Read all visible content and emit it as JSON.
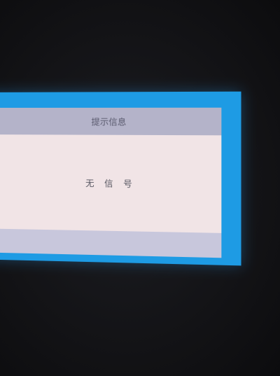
{
  "dialog": {
    "title": "提示信息",
    "message": "无信号"
  }
}
